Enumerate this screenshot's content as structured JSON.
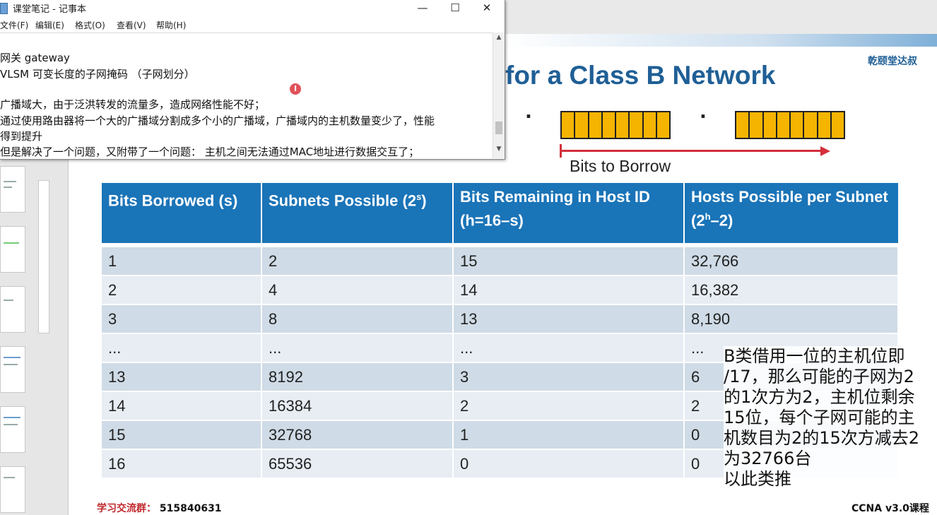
{
  "notepad": {
    "title": "课堂笔记 - 记事本",
    "controls": {
      "minimize": "—",
      "maximize": "☐",
      "close": "✕"
    },
    "menu": [
      "文件(F)",
      "编辑(E)",
      "格式(O)",
      "查看(V)",
      "帮助(H)"
    ],
    "lines": [
      "网关  gateway",
      "VLSM  可变长度的子网掩码  （子网划分）",
      "",
      "广播域大，由于泛洪转发的流量多，造成网络性能不好；",
      "通过使用路由器将一个大的广播域分割成多个小的广播域，广播域内的主机数量变少了，性能",
      "得到提升",
      "但是解决了一个问题，又附带了一个问题：  主机之间无法通过MAC地址进行数据交互了；"
    ]
  },
  "slide": {
    "title": "for a Class B Network",
    "brand": "乾颐堂达叔",
    "dot": ".",
    "bits_to_borrow": "Bits to Borrow",
    "table": {
      "headers": [
        {
          "text": "Bits Borrowed (s)",
          "sup": "",
          "tail": ""
        },
        {
          "text": "Subnets Possible (2",
          "sup": "s",
          "tail": ")"
        },
        {
          "text": "Bits Remaining in Host ID (h=16–s)",
          "sup": "",
          "tail": ""
        },
        {
          "text": "Hosts Possible per Subnet (2",
          "sup": "h",
          "tail": "–2)"
        }
      ],
      "rows": [
        [
          "1",
          "2",
          "15",
          "32,766"
        ],
        [
          "2",
          "4",
          "14",
          "16,382"
        ],
        [
          "3",
          "8",
          "13",
          "8,190"
        ],
        [
          "...",
          "...",
          "...",
          "..."
        ],
        [
          "13",
          "8192",
          "3",
          "6"
        ],
        [
          "14",
          "16384",
          "2",
          "2"
        ],
        [
          "15",
          "32768",
          "1",
          "0"
        ],
        [
          "16",
          "65536",
          "0",
          "0"
        ]
      ]
    },
    "note": "B类借用一位的主机位即\n/17，那么可能的子网为2\n的1次方为2，主机位剩余\n15位，每个子网可能的主\n机数目为2的15次方减去2\n为32766台\n以此类推",
    "group_label": "学习交流群：",
    "group_number": "515840631",
    "footer": "CCNA v3.0课程"
  },
  "cursor_glyph": "I",
  "colors": {
    "header_blue": "#1a74b8",
    "title_blue": "#1f5f96",
    "octet_yellow": "#f5b400",
    "arrow_red": "#d4303c",
    "row_dark": "#cfdbe6",
    "row_light": "#e7edf3"
  }
}
